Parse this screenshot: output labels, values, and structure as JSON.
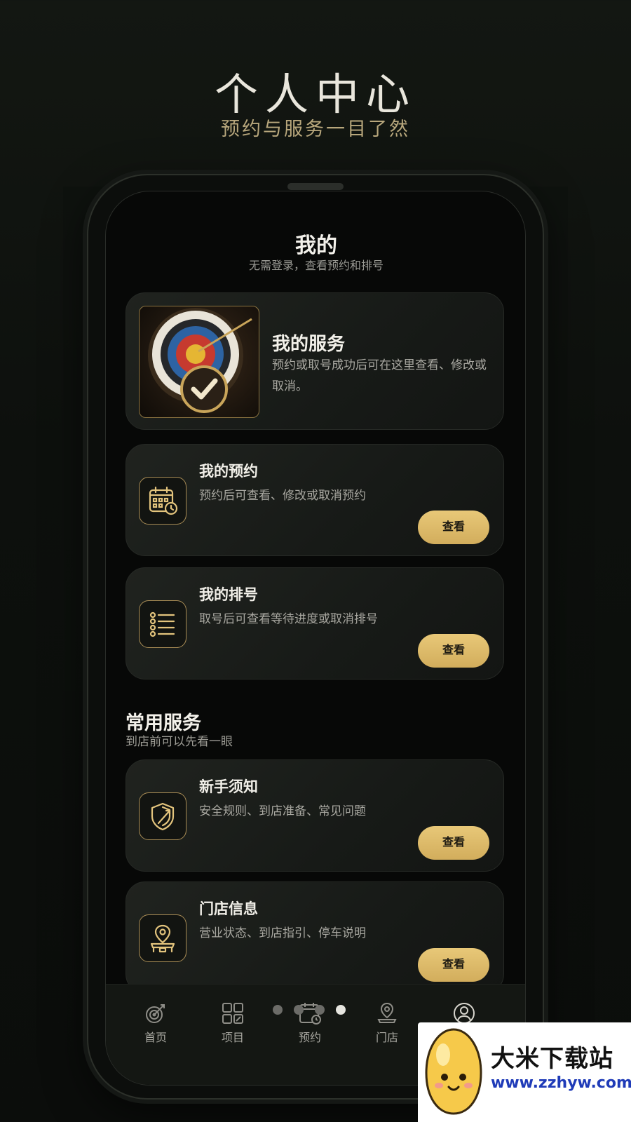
{
  "promo": {
    "title": "个人中心",
    "subtitle": "预约与服务一目了然"
  },
  "screen": {
    "title": "我的",
    "subtitle": "无需登录，查看预约和排号"
  },
  "hero": {
    "title": "我的服务",
    "description": "预约或取号成功后可在这里查看、修改或取消。",
    "image_icon": "archery-target-check-icon"
  },
  "cards": [
    {
      "title": "我的预约",
      "description": "预约后可查看、修改或取消预约",
      "button": "查看",
      "icon": "calendar-clock-icon"
    },
    {
      "title": "我的排号",
      "description": "取号后可查看等待进度或取消排号",
      "button": "查看",
      "icon": "queue-list-icon"
    }
  ],
  "section": {
    "title": "常用服务",
    "subtitle": "到店前可以先看一眼"
  },
  "services": [
    {
      "title": "新手须知",
      "description": "安全规则、到店准备、常见问题",
      "button": "查看",
      "icon": "shield-arrow-icon"
    },
    {
      "title": "门店信息",
      "description": "营业状态、到店指引、停车说明",
      "button": "查看",
      "icon": "store-location-icon"
    }
  ],
  "tabbar": {
    "items": [
      {
        "label": "首页",
        "icon": "target-icon"
      },
      {
        "label": "项目",
        "icon": "grid-icon"
      },
      {
        "label": "预约",
        "icon": "calendar-icon"
      },
      {
        "label": "门店",
        "icon": "map-pin-icon"
      },
      {
        "label": "",
        "icon": "user-icon",
        "active": true
      }
    ]
  },
  "watermark": {
    "name": "大米下载站",
    "url": "www.zzhyw.com"
  },
  "colors": {
    "gold": "#d8b565",
    "background": "#0b0d0b",
    "card": "#1b1e1a"
  }
}
